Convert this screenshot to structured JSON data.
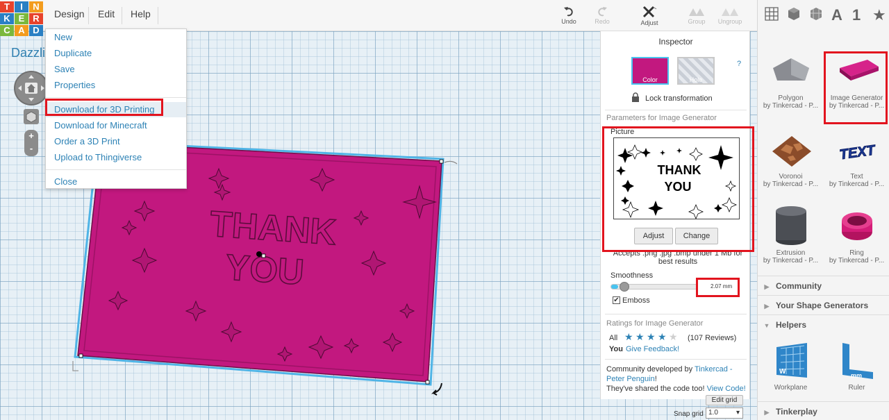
{
  "app": {
    "logo_letters": [
      "T",
      "I",
      "N",
      "K",
      "E",
      "R",
      "C",
      "A",
      "D"
    ],
    "project_name": "Dazzli"
  },
  "menu": {
    "design": "Design",
    "edit": "Edit",
    "help": "Help"
  },
  "toolbar": {
    "undo": "Undo",
    "redo": "Redo",
    "adjust": "Adjust",
    "group": "Group",
    "ungroup": "Ungroup"
  },
  "design_menu": {
    "items": [
      "New",
      "Duplicate",
      "Save",
      "Properties",
      "Download for 3D Printing",
      "Download for Minecraft",
      "Order a 3D Print",
      "Upload to Thingiverse",
      "Close"
    ],
    "highlighted": "Download for 3D Printing"
  },
  "inspector": {
    "title": "Inspector",
    "color_label": "Color",
    "hole_label": "Hole",
    "help": "?",
    "lock_label": "Lock transformation",
    "params_title": "Parameters for Image Generator",
    "picture_label": "Picture",
    "picture_text_line1": "THANK",
    "picture_text_line2": "YOU",
    "adjust_button": "Adjust",
    "change_button": "Change",
    "accepts_text": "Accepts .png .jpg .bmp under 1 Mb for",
    "accepts_text2": "best results",
    "smoothness_label": "Smoothness",
    "smoothness_value": "2.07 mm",
    "smoothness_level": 0.08,
    "emboss_label": "Emboss",
    "emboss_checked": true,
    "ratings_title": "Ratings for Image Generator",
    "ratings_all_label": "All",
    "ratings_all_stars": 4,
    "ratings_count": "(107 Reviews)",
    "ratings_you_label": "You",
    "give_feedback": "Give Feedback!",
    "community_text": "Community developed by",
    "community_author": "Tinkercad -",
    "community_author2": "Peter Penguin",
    "community_bang": "!",
    "shared_text": "They've shared the code too!",
    "view_code": "View Code!",
    "edit_grid": "Edit grid",
    "snap_grid_label": "Snap grid",
    "snap_grid_value": "1.0"
  },
  "workspace": {
    "plate_text_line1": "THANK",
    "plate_text_line2": "YOU"
  },
  "library": {
    "view_text_icon": "A",
    "view_number_icon": "1",
    "view_star_icon": "★",
    "shapes": [
      {
        "name": "Polygon",
        "by": "by Tinkercad - P..."
      },
      {
        "name": "Image Generator",
        "by": "by Tinkercad - P..."
      },
      {
        "name": "Voronoi",
        "by": "by Tinkercad - P..."
      },
      {
        "name": "Text",
        "by": "by Tinkercad - P..."
      },
      {
        "name": "Extrusion",
        "by": "by Tinkercad - P..."
      },
      {
        "name": "Ring",
        "by": "by Tinkercad - P..."
      }
    ],
    "text_shape_art": "TEXT",
    "sections": {
      "community": "Community",
      "generators": "Your Shape Generators",
      "helpers": "Helpers",
      "tinkerplay": "Tinkerplay"
    },
    "helpers": [
      {
        "name": "Workplane"
      },
      {
        "name": "Ruler"
      }
    ],
    "workplane_glyph": "W",
    "ruler_glyph": "mm"
  },
  "colors": {
    "accent": "#2d82b5",
    "plate": "#c2187f",
    "highlight_red": "#e2141e",
    "logo": [
      "#e8432c",
      "#2a80c4",
      "#f39c1e",
      "#2a80c4",
      "#7ab83c",
      "#e8432c",
      "#7ab83c",
      "#f39c1e",
      "#2a80c4"
    ]
  }
}
